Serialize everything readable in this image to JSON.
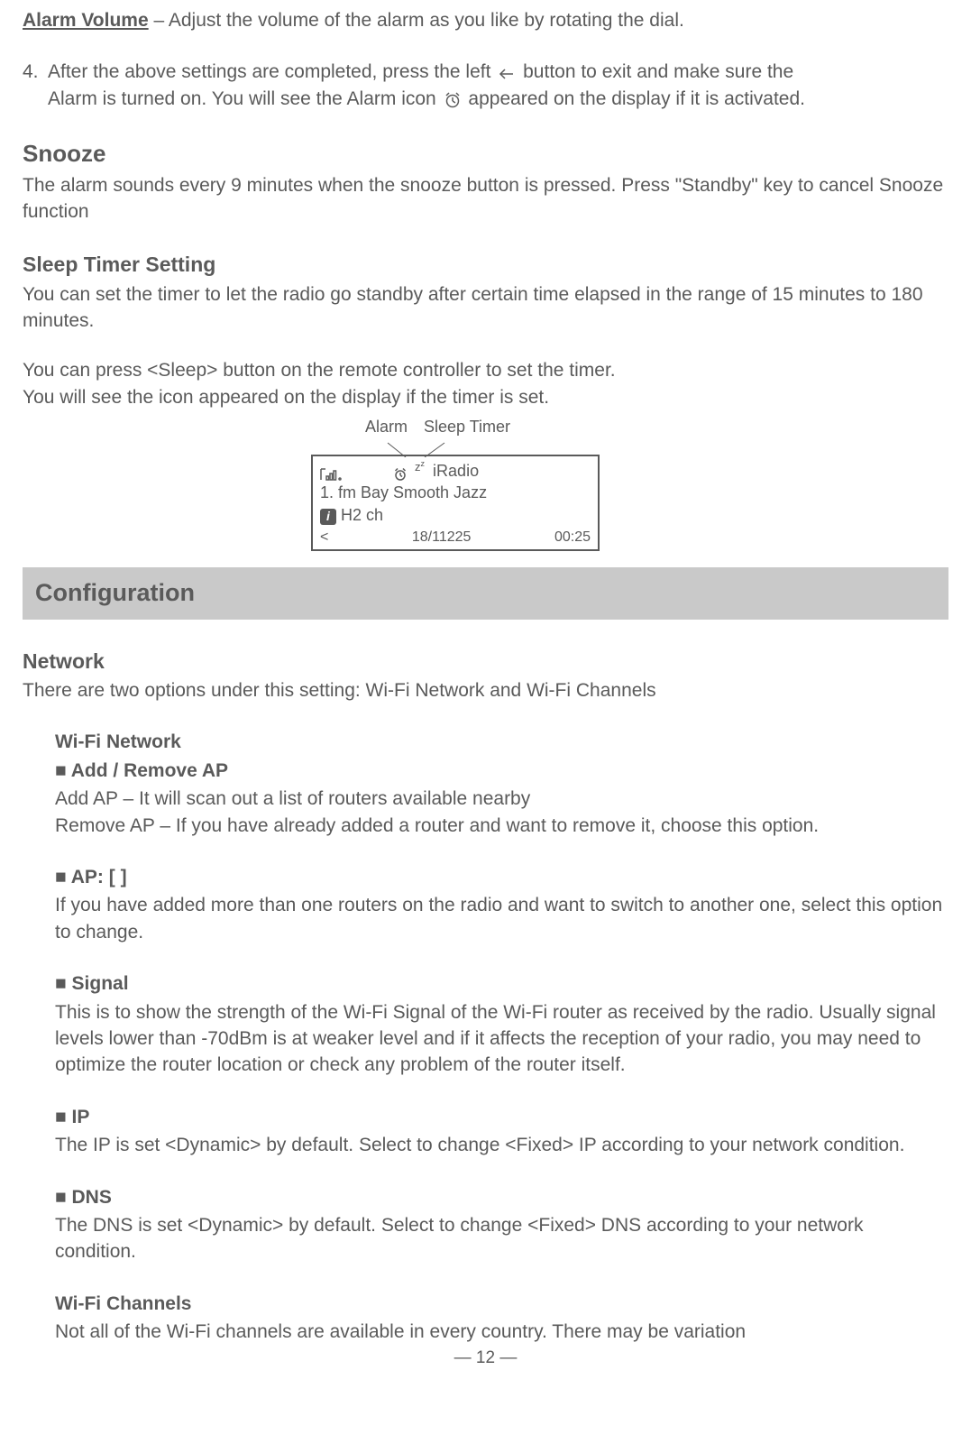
{
  "alarm_volume": {
    "label": "Alarm Volume",
    "text": " – Adjust the volume of the alarm as you like by rotating the dial."
  },
  "step4": {
    "num": "4.",
    "line_a1": "After the above settings are completed, press the left ",
    "line_a2": " button to exit and make sure the",
    "line_b1": "Alarm is turned on. You will see the Alarm icon ",
    "line_b2": "  appeared on the display if it is activated."
  },
  "snooze": {
    "title": "Snooze",
    "text": "The alarm sounds every 9 minutes when the snooze button is pressed.  Press \"Standby\" key to cancel Snooze function"
  },
  "sleep": {
    "title": "Sleep Timer Setting",
    "p1": "You can set the timer to let the radio go standby after certain time elapsed in the range of 15 minutes to 180 minutes.",
    "p2": "You can press <Sleep> button on the remote controller to set the timer.",
    "p3": "You will see the icon   appeared on the display if the timer is set."
  },
  "display": {
    "label_alarm": "Alarm",
    "label_sleep": "Sleep Timer",
    "zz": "z",
    "iradio": "iRadio",
    "line2": "1. fm Bay Smooth Jazz",
    "line3": " H2 ch",
    "bottom_lt": "<",
    "bottom_mid": "18/11225",
    "bottom_rt": "00:25"
  },
  "config_header": "Configuration",
  "network": {
    "title": "Network",
    "intro": "There are two options under this setting: Wi-Fi Network and Wi-Fi Channels",
    "wifi_net_title": "Wi-Fi Network",
    "add_remove": {
      "title": "■ Add / Remove AP",
      "p1": "Add AP – It will scan out a list of routers available nearby",
      "p2": "Remove AP – If you have already added a router and want to remove it, choose this option."
    },
    "ap": {
      "title": "■ AP: [ ]",
      "p": "If you have added more than one routers on the radio and want to switch to another one, select this option to change."
    },
    "signal": {
      "title": "■ Signal",
      "p": "This is to show the strength of the Wi-Fi Signal of the Wi-Fi router as received by the radio. Usually signal levels lower than -70dBm is at weaker level and if it affects the reception of your radio, you may need to optimize the router location or check any problem of the router itself."
    },
    "ip": {
      "title": "■ IP",
      "p": "The IP is set <Dynamic> by default. Select to change <Fixed> IP according to your network condition."
    },
    "dns": {
      "title": "■ DNS",
      "p": "The DNS is set <Dynamic> by default. Select to change <Fixed> DNS according to your network condition."
    },
    "wifi_ch": {
      "title": "Wi-Fi Channels",
      "p": "Not all of the Wi-Fi channels are available in every country. There may be variation"
    }
  },
  "pagenum": "12"
}
